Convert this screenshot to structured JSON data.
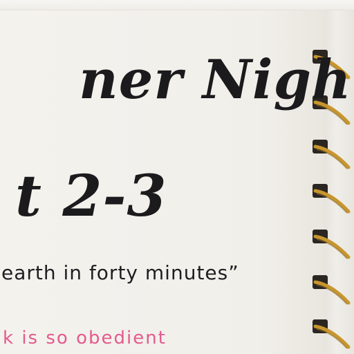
{
  "notebook": {
    "title_line1": "ner Night's",
    "title_line2": "t 2-3",
    "subtitle": "earth in forty minutes”",
    "note": "k is so obedient"
  },
  "colors": {
    "paper": "#f2f0eb",
    "ink": "#1b1a1c",
    "pink_ink": "#e45a8f",
    "ring_gold": "#c8962e"
  }
}
